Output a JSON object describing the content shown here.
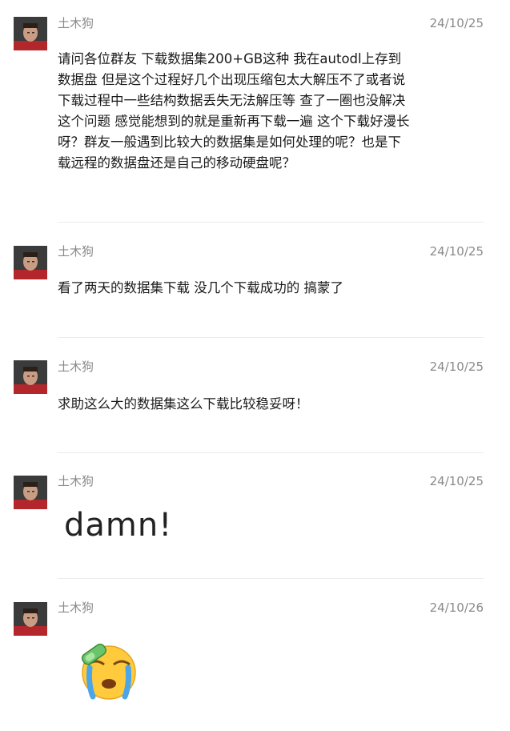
{
  "messages": [
    {
      "sender": "土木狗",
      "time": "24/10/25",
      "text": "请问各位群友 下载数据集200+GB这种 我在autodl上存到数据盘 但是这个过程好几个出现压缩包太大解压不了或者说下载过程中一些结构数据丢失无法解压等 查了一圈也没解决这个问题 感觉能想到的就是重新再下载一遍 这个下载好漫长呀？群友一般遇到比较大的数据集是如何处理的呢？也是下载远程的数据盘还是自己的移动硬盘呢？"
    },
    {
      "sender": "土木狗",
      "time": "24/10/25",
      "text": "看了两天的数据集下载 没几个下载成功的 搞蒙了"
    },
    {
      "sender": "土木狗",
      "time": "24/10/25",
      "text": "求助这么大的数据集这么下载比较稳妥呀！"
    },
    {
      "sender": "土木狗",
      "time": "24/10/25",
      "sticker_text": "damn!"
    },
    {
      "sender": "土木狗",
      "time": "24/10/26",
      "emoji": "crying-face-emoji"
    }
  ]
}
